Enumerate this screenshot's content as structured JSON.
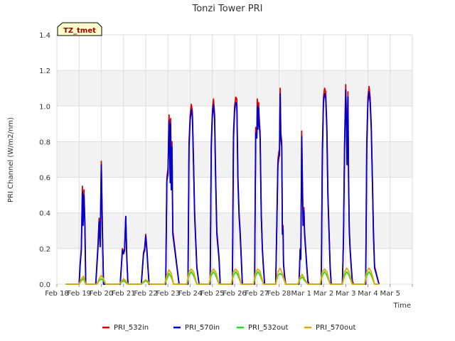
{
  "chart_data": {
    "type": "line",
    "title": "Tonzi Tower PRI",
    "xlabel": "Time",
    "ylabel": "PRI Channel (W/m2/nm)",
    "annotation": "TZ_tmet",
    "ylim": [
      0,
      1.4
    ],
    "xlim": [
      0,
      16
    ],
    "yticks": [
      0.0,
      0.2,
      0.4,
      0.6,
      0.8,
      1.0,
      1.2,
      1.4
    ],
    "ytick_labels": [
      "0.0",
      "0.2",
      "0.4",
      "0.6",
      "0.8",
      "1.0",
      "1.2",
      "1.4"
    ],
    "xticks": [
      0,
      1,
      2,
      3,
      4,
      5,
      6,
      7,
      8,
      9,
      10,
      11,
      12,
      13,
      14,
      15,
      16
    ],
    "xtick_labels": [
      "Feb 18",
      "Feb 19",
      "Feb 20",
      "Feb 21",
      "Feb 22",
      "Feb 23",
      "Feb 24",
      "Feb 25",
      "Feb 26",
      "Feb 27",
      "Feb 28",
      "Mar 1",
      "Mar 2",
      "Mar 3",
      "Mar 4",
      "Mar 5"
    ],
    "xtick_label_positions": [
      0,
      1,
      2,
      3,
      4,
      5,
      6,
      7,
      8,
      9,
      10,
      11,
      12,
      13,
      14,
      15
    ],
    "grid": true,
    "legend_position": "bottom",
    "series": [
      {
        "name": "PRI_532in",
        "color": "#dd0000",
        "x": [
          0.4,
          1.0,
          1.05,
          1.1,
          1.15,
          1.18,
          1.22,
          1.26,
          1.3,
          1.5,
          1.75,
          1.85,
          1.9,
          1.95,
          2.0,
          2.05,
          2.1,
          2.15,
          2.3,
          2.85,
          2.95,
          3.0,
          3.05,
          3.1,
          3.15,
          3.2,
          3.4,
          3.8,
          3.9,
          3.95,
          4.0,
          4.05,
          4.1,
          4.15,
          4.35,
          4.9,
          4.95,
          5.0,
          5.05,
          5.1,
          5.12,
          5.15,
          5.18,
          5.22,
          5.5,
          5.9,
          5.95,
          6.0,
          6.05,
          6.1,
          6.15,
          6.2,
          6.3,
          6.4,
          6.9,
          6.95,
          7.0,
          7.05,
          7.1,
          7.15,
          7.2,
          7.3,
          7.35,
          7.9,
          7.95,
          8.0,
          8.05,
          8.1,
          8.15,
          8.2,
          8.25,
          8.3,
          8.35,
          8.9,
          8.95,
          9.0,
          9.02,
          9.05,
          9.08,
          9.1,
          9.15,
          9.2,
          9.25,
          9.3,
          9.35,
          9.85,
          9.9,
          9.95,
          10.0,
          10.02,
          10.05,
          10.08,
          10.12,
          10.15,
          10.18,
          10.2,
          10.25,
          10.3,
          10.35,
          10.9,
          10.95,
          10.98,
          11.0,
          11.02,
          11.05,
          11.08,
          11.12,
          11.15,
          11.2,
          11.25,
          11.3,
          11.35,
          11.9,
          11.95,
          12.0,
          12.05,
          12.1,
          12.15,
          12.2,
          12.3,
          12.35,
          12.85,
          12.9,
          12.95,
          13.0,
          13.03,
          13.06,
          13.1,
          13.13,
          13.16,
          13.2,
          13.25,
          13.3,
          13.35,
          13.9,
          13.95,
          14.0,
          14.05,
          14.1,
          14.15,
          14.2,
          14.25,
          14.3,
          14.5
        ],
        "y": [
          0,
          0,
          0.12,
          0.2,
          0.55,
          0.35,
          0.53,
          0.35,
          0,
          0,
          0,
          0.22,
          0.37,
          0.22,
          0.69,
          0.3,
          0,
          0,
          0,
          0,
          0.2,
          0.18,
          0.2,
          0.38,
          0.15,
          0,
          0,
          0,
          0.18,
          0.2,
          0.28,
          0.2,
          0.1,
          0,
          0,
          0,
          0.6,
          0.65,
          0.95,
          0.6,
          0.93,
          0.55,
          0.8,
          0.3,
          0,
          0,
          0.8,
          0.95,
          1.01,
          0.97,
          0.7,
          0.4,
          0.1,
          0,
          0,
          0.8,
          0.98,
          1.04,
          0.95,
          0.6,
          0.3,
          0.15,
          0,
          0,
          0.85,
          1.0,
          1.05,
          1.04,
          0.6,
          0.4,
          0.3,
          0.15,
          0,
          0,
          0.88,
          0.85,
          1.04,
          0.9,
          1.02,
          0.95,
          0.85,
          0.4,
          0.2,
          0.1,
          0,
          0,
          0.35,
          0.7,
          0.75,
          0.75,
          1.1,
          0.85,
          0.8,
          0.3,
          0.33,
          0.12,
          0.05,
          0,
          0,
          0,
          0.2,
          0.15,
          0.5,
          0.86,
          0.6,
          0.35,
          0.43,
          0.3,
          0.2,
          0.1,
          0.02,
          0,
          0,
          0.75,
          1.05,
          1.1,
          1.08,
          0.9,
          0.5,
          0.1,
          0,
          0,
          0.25,
          0.8,
          1.12,
          0.95,
          0.7,
          1.08,
          0.6,
          0.32,
          0.2,
          0.1,
          0.02,
          0,
          0,
          0.8,
          1.05,
          1.11,
          1.05,
          0.9,
          0.6,
          0.3,
          0.1,
          0
        ]
      },
      {
        "name": "PRI_570in",
        "color": "#0000cc",
        "x": [
          0.4,
          1.0,
          1.05,
          1.1,
          1.15,
          1.18,
          1.22,
          1.26,
          1.3,
          1.5,
          1.75,
          1.85,
          1.9,
          1.95,
          2.0,
          2.05,
          2.1,
          2.15,
          2.3,
          2.85,
          2.95,
          3.0,
          3.05,
          3.1,
          3.15,
          3.2,
          3.4,
          3.8,
          3.9,
          3.95,
          4.0,
          4.05,
          4.1,
          4.15,
          4.35,
          4.9,
          4.95,
          5.0,
          5.05,
          5.1,
          5.12,
          5.15,
          5.18,
          5.22,
          5.5,
          5.9,
          5.95,
          6.0,
          6.05,
          6.1,
          6.15,
          6.2,
          6.3,
          6.4,
          6.9,
          6.95,
          7.0,
          7.05,
          7.1,
          7.15,
          7.2,
          7.3,
          7.35,
          7.9,
          7.95,
          8.0,
          8.05,
          8.1,
          8.15,
          8.2,
          8.25,
          8.3,
          8.35,
          8.9,
          8.95,
          9.0,
          9.02,
          9.05,
          9.08,
          9.1,
          9.15,
          9.2,
          9.25,
          9.3,
          9.35,
          9.85,
          9.9,
          9.95,
          10.0,
          10.02,
          10.05,
          10.08,
          10.12,
          10.15,
          10.18,
          10.2,
          10.25,
          10.3,
          10.35,
          10.9,
          10.95,
          10.98,
          11.0,
          11.02,
          11.05,
          11.08,
          11.12,
          11.15,
          11.2,
          11.25,
          11.3,
          11.35,
          11.9,
          11.95,
          12.0,
          12.05,
          12.1,
          12.15,
          12.2,
          12.3,
          12.35,
          12.85,
          12.9,
          12.95,
          13.0,
          13.03,
          13.06,
          13.1,
          13.13,
          13.16,
          13.2,
          13.25,
          13.3,
          13.35,
          13.9,
          13.95,
          14.0,
          14.05,
          14.1,
          14.15,
          14.2,
          14.25,
          14.3,
          14.5
        ],
        "y": [
          0,
          0,
          0.11,
          0.19,
          0.52,
          0.33,
          0.5,
          0.33,
          0,
          0,
          0,
          0.2,
          0.35,
          0.21,
          0.67,
          0.28,
          0,
          0,
          0,
          0,
          0.19,
          0.17,
          0.19,
          0.38,
          0.14,
          0,
          0,
          0,
          0.17,
          0.19,
          0.27,
          0.19,
          0.09,
          0,
          0,
          0,
          0.58,
          0.62,
          0.92,
          0.57,
          0.9,
          0.53,
          0.77,
          0.28,
          0,
          0,
          0.77,
          0.92,
          0.98,
          0.94,
          0.67,
          0.38,
          0.09,
          0,
          0,
          0.77,
          0.95,
          1.01,
          0.92,
          0.57,
          0.28,
          0.14,
          0,
          0,
          0.82,
          0.97,
          1.02,
          1.01,
          0.57,
          0.38,
          0.28,
          0.14,
          0,
          0,
          0.85,
          0.82,
          1.0,
          0.87,
          0.99,
          0.92,
          0.82,
          0.38,
          0.19,
          0.09,
          0,
          0,
          0.33,
          0.67,
          0.72,
          0.72,
          1.07,
          0.82,
          0.77,
          0.28,
          0.31,
          0.11,
          0.04,
          0,
          0,
          0,
          0.19,
          0.14,
          0.48,
          0.83,
          0.58,
          0.33,
          0.41,
          0.28,
          0.19,
          0.09,
          0.01,
          0,
          0,
          0.72,
          1.02,
          1.07,
          1.05,
          0.87,
          0.48,
          0.09,
          0,
          0,
          0.24,
          0.77,
          1.09,
          0.92,
          0.67,
          1.05,
          0.58,
          0.3,
          0.19,
          0.09,
          0.01,
          0,
          0,
          0.77,
          1.02,
          1.08,
          1.02,
          0.87,
          0.58,
          0.28,
          0.09,
          0
        ]
      },
      {
        "name": "PRI_532out",
        "color": "#22dd22",
        "x": [
          0.4,
          1.0,
          1.1,
          1.2,
          1.3,
          1.5,
          1.8,
          1.9,
          2.0,
          2.1,
          2.2,
          2.8,
          2.9,
          3.0,
          3.1,
          3.2,
          3.8,
          3.9,
          4.0,
          4.1,
          4.2,
          4.85,
          4.95,
          5.05,
          5.15,
          5.25,
          5.85,
          5.95,
          6.05,
          6.15,
          6.3,
          6.85,
          6.95,
          7.05,
          7.15,
          7.3,
          7.85,
          7.95,
          8.05,
          8.15,
          8.3,
          8.85,
          8.95,
          9.05,
          9.15,
          9.3,
          9.85,
          9.95,
          10.05,
          10.15,
          10.3,
          10.85,
          10.95,
          11.05,
          11.15,
          11.3,
          11.85,
          11.95,
          12.05,
          12.15,
          12.3,
          12.85,
          12.95,
          13.05,
          13.15,
          13.3,
          13.85,
          13.95,
          14.05,
          14.15,
          14.3,
          14.5
        ],
        "y": [
          0,
          0,
          0.02,
          0.03,
          0,
          0,
          0,
          0.02,
          0.03,
          0.02,
          0,
          0,
          0.01,
          0.02,
          0.01,
          0,
          0,
          0.01,
          0.02,
          0.01,
          0,
          0,
          0.03,
          0.06,
          0.04,
          0,
          0,
          0.05,
          0.07,
          0.05,
          0,
          0,
          0.05,
          0.07,
          0.05,
          0,
          0,
          0.05,
          0.07,
          0.05,
          0,
          0,
          0.05,
          0.07,
          0.05,
          0,
          0,
          0.05,
          0.06,
          0.05,
          0,
          0,
          0.03,
          0.04,
          0.02,
          0,
          0,
          0.05,
          0.07,
          0.05,
          0,
          0,
          0.05,
          0.07,
          0.05,
          0,
          0,
          0.05,
          0.07,
          0.05,
          0,
          0
        ]
      },
      {
        "name": "PRI_570out",
        "color": "#e6a800",
        "x": [
          0.4,
          1.0,
          1.1,
          1.2,
          1.3,
          1.5,
          1.8,
          1.9,
          2.0,
          2.1,
          2.2,
          2.8,
          2.9,
          3.0,
          3.1,
          3.2,
          3.8,
          3.9,
          4.0,
          4.1,
          4.2,
          4.85,
          4.95,
          5.05,
          5.15,
          5.25,
          5.85,
          5.95,
          6.05,
          6.15,
          6.3,
          6.85,
          6.95,
          7.05,
          7.15,
          7.3,
          7.85,
          7.95,
          8.05,
          8.15,
          8.3,
          8.85,
          8.95,
          9.05,
          9.15,
          9.3,
          9.85,
          9.95,
          10.05,
          10.15,
          10.3,
          10.85,
          10.95,
          11.05,
          11.15,
          11.3,
          11.85,
          11.95,
          12.05,
          12.15,
          12.3,
          12.85,
          12.95,
          13.05,
          13.15,
          13.3,
          13.85,
          13.95,
          14.05,
          14.15,
          14.3,
          14.5
        ],
        "y": [
          0,
          0,
          0.03,
          0.045,
          0,
          0,
          0,
          0.03,
          0.05,
          0.03,
          0,
          0,
          0.015,
          0.03,
          0.02,
          0,
          0,
          0.015,
          0.025,
          0.015,
          0,
          0,
          0.05,
          0.08,
          0.06,
          0,
          0,
          0.07,
          0.085,
          0.07,
          0,
          0,
          0.07,
          0.085,
          0.07,
          0,
          0,
          0.07,
          0.085,
          0.07,
          0,
          0,
          0.07,
          0.085,
          0.07,
          0,
          0,
          0.07,
          0.09,
          0.06,
          0,
          0,
          0.04,
          0.055,
          0.03,
          0,
          0,
          0.07,
          0.085,
          0.07,
          0,
          0,
          0.07,
          0.09,
          0.07,
          0,
          0,
          0.07,
          0.09,
          0.07,
          0,
          0
        ]
      }
    ]
  }
}
